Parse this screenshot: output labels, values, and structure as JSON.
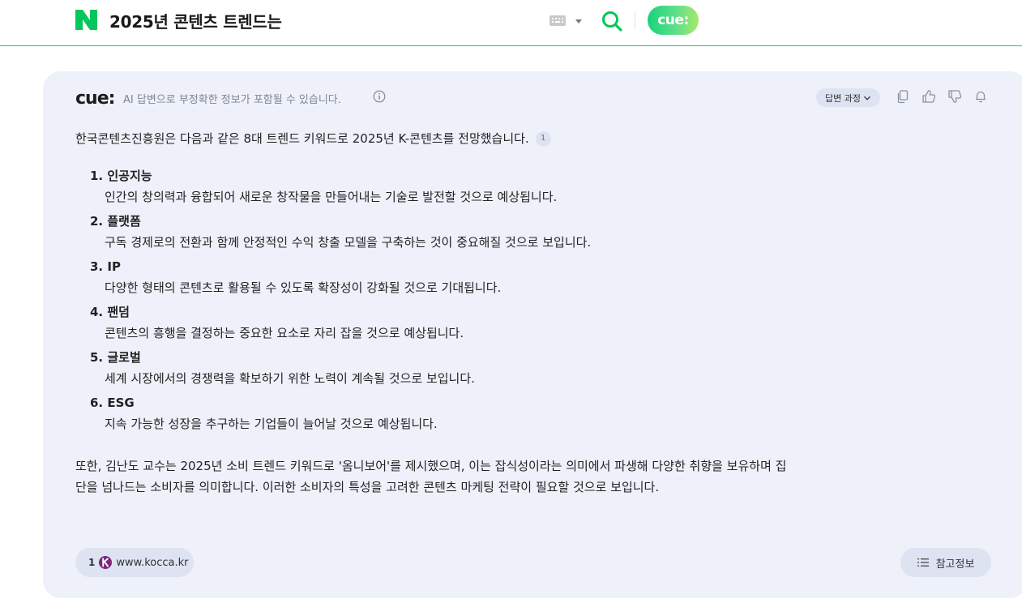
{
  "header": {
    "logo_icon": "naver-n-logo",
    "query": "2025년 콘텐츠 트렌드는",
    "keyboard_icon": "keyboard-icon",
    "search_icon": "search-icon",
    "cue_button_label": "cue:"
  },
  "card": {
    "brand": "cue:",
    "notice": "AI 답변으로 부정확한 정보가 포함될 수 있습니다.",
    "process_label": "답변 과정",
    "tools": [
      "copy-icon",
      "thumbs-up-icon",
      "thumbs-down-icon",
      "bell-icon"
    ],
    "intro": "한국콘텐츠진흥원은 다음과 같은 8대 트렌드 키워드로 2025년 K-콘텐츠를 전망했습니다.",
    "intro_citation": "1",
    "trends": [
      {
        "title": "1. 인공지능",
        "desc": "인간의 창의력과 융합되어 새로운 창작물을 만들어내는 기술로 발전할 것으로 예상됩니다."
      },
      {
        "title": "2. 플랫폼",
        "desc": "구독 경제로의 전환과 함께 안정적인 수익 창출 모델을 구축하는 것이 중요해질 것으로 보입니다."
      },
      {
        "title": "3. IP",
        "desc": "다양한 형태의 콘텐츠로 활용될 수 있도록 확장성이 강화될 것으로 기대됩니다."
      },
      {
        "title": "4. 팬덤",
        "desc": "콘텐츠의 흥행을 결정하는 중요한 요소로 자리 잡을 것으로 예상됩니다."
      },
      {
        "title": "5. 글로벌",
        "desc": "세계 시장에서의 경쟁력을 확보하기 위한 노력이 계속될 것으로 보입니다."
      },
      {
        "title": "6. ESG",
        "desc": "지속 가능한 성장을 추구하는 기업들이 늘어날 것으로 예상됩니다."
      }
    ],
    "outro": "또한, 김난도 교수는 2025년 소비 트렌드 키워드로 '옴니보어'를 제시했으며, 이는 잡식성이라는 의미에서 파생해 다양한 취향을 보유하며 집단을 넘나드는 소비자를 의미합니다. 이러한 소비자의 특성을 고려한 콘텐츠 마케팅 전략이 필요할 것으로 보입니다.",
    "source": {
      "num": "1",
      "domain": "www.kocca.kr",
      "logo": "kocca-logo-icon"
    },
    "reference_label": "참고정보",
    "reference_icon": "list-icon"
  },
  "colors": {
    "naver_green": "#03c75a",
    "header_border": "#1fbf85",
    "card_bg": "#eef1f9",
    "chip_bg": "#dde3f1",
    "kocca_purple": "#7a2a7d"
  }
}
